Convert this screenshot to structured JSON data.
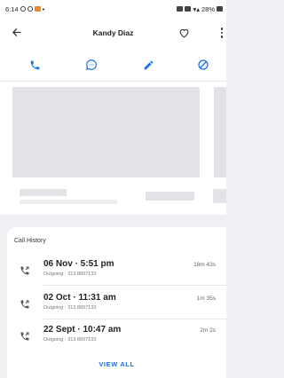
{
  "status_bar": {
    "time": "6:14",
    "battery": "28%"
  },
  "header": {
    "contact_name": "Kandy Diaz",
    "back_icon": "back-arrow-icon",
    "favorite_icon": "heart-outline-icon",
    "more_icon": "more-vert-icon"
  },
  "actions": {
    "icons": [
      "phone-icon",
      "message-icon",
      "edit-pencil-icon",
      "block-icon"
    ],
    "accent_color": "#1a73e8"
  },
  "call_history": {
    "title": "Call History",
    "calls": [
      {
        "date": "06 Nov · 5:51 pm",
        "detail": "Outgoing · 313 8897133",
        "duration": "18m 43s"
      },
      {
        "date": "02 Oct · 11:31 am",
        "detail": "Outgoing · 313 8897133",
        "duration": "1m 35s"
      },
      {
        "date": "22 Sept · 10:47 am",
        "detail": "Outgoing · 313 8897133",
        "duration": "2m 2s"
      }
    ],
    "view_all_label": "VIEW ALL"
  }
}
